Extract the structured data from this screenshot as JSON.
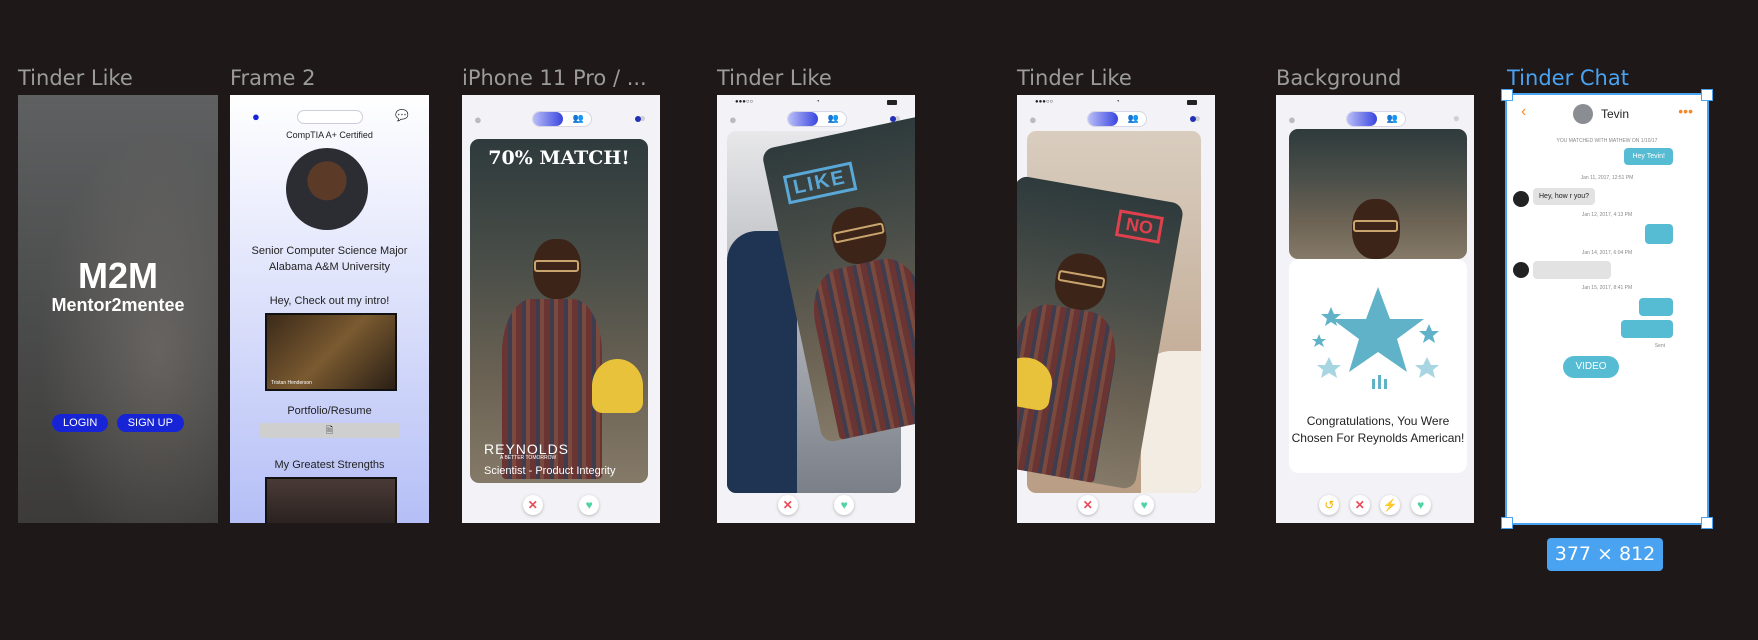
{
  "frames": {
    "labels": [
      "Tinder Like",
      "Frame 2",
      "iPhone 11 Pro / ...",
      "Tinder Like",
      "Tinder Like",
      "Background",
      "Tinder Chat"
    ]
  },
  "f1": {
    "title": "M2M",
    "subtitle": "Mentor2mentee",
    "login": "LOGIN",
    "signup": "SIGN UP"
  },
  "f2": {
    "cert": "CompTIA A+ Certified",
    "bio_line1": "Senior Computer Science Major",
    "bio_line2": "Alabama A&M University",
    "intro_heading": "Hey, Check out my intro!",
    "video_caption": "Tristan Henderson",
    "portfolio_heading": "Portfolio/Resume",
    "strengths_heading": "My Greatest Strengths"
  },
  "f3": {
    "match": "70% MATCH!",
    "brand": "REYNOLDS",
    "tagline": "A BETTER TOMORROW",
    "role": "Scientist - Product Integrity"
  },
  "f4": {
    "stamp": "LIKE"
  },
  "f5": {
    "stamp": "NO"
  },
  "f6": {
    "congrats_line1": "Congratulations, You Were",
    "congrats_line2": "Chosen For Reynolds American!"
  },
  "f7": {
    "name": "Tevin",
    "matched_note": "YOU MATCHED WITH MATHEW ON 1/10/17",
    "msg1": "Hey Tevin!",
    "ts1": "Jan 11, 2017, 12:51 PM",
    "msg2": "Hey, how r you?",
    "ts2": "Jan 12, 2017, 4:13 PM",
    "ts3": "Jan 14, 2017, 6:04 PM",
    "ts4": "Jan 15, 2017, 8:41 PM",
    "sent_label": "Sent",
    "video_btn": "VIDEO"
  },
  "selection": {
    "size": "377 × 812"
  },
  "colors": {
    "canvas": "#1e1818",
    "selection": "#4aa3f0",
    "primary_blue": "#1624d6",
    "teal": "#5fb2c7",
    "chat_blue": "#55bcd3"
  }
}
